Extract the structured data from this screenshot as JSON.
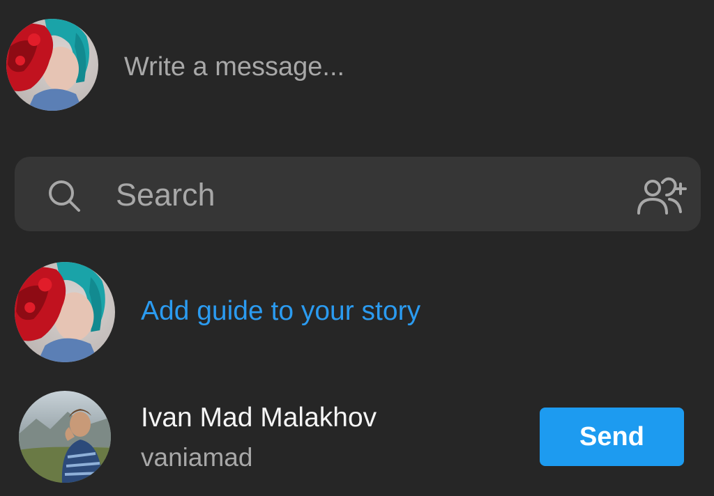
{
  "composer": {
    "placeholder": "Write a message..."
  },
  "search": {
    "placeholder": "Search",
    "icon": "search-icon",
    "add_people_icon": "add-people-icon"
  },
  "story": {
    "label": "Add guide to your story"
  },
  "contacts": [
    {
      "name": "Ivan Mad Malakhov",
      "username": "vaniamad",
      "action_label": "Send"
    }
  ],
  "colors": {
    "background": "#262626",
    "search_background": "#363636",
    "link": "#2b9bf0",
    "primary_button": "#1d9bf0",
    "secondary_text": "#a8a8a8"
  }
}
